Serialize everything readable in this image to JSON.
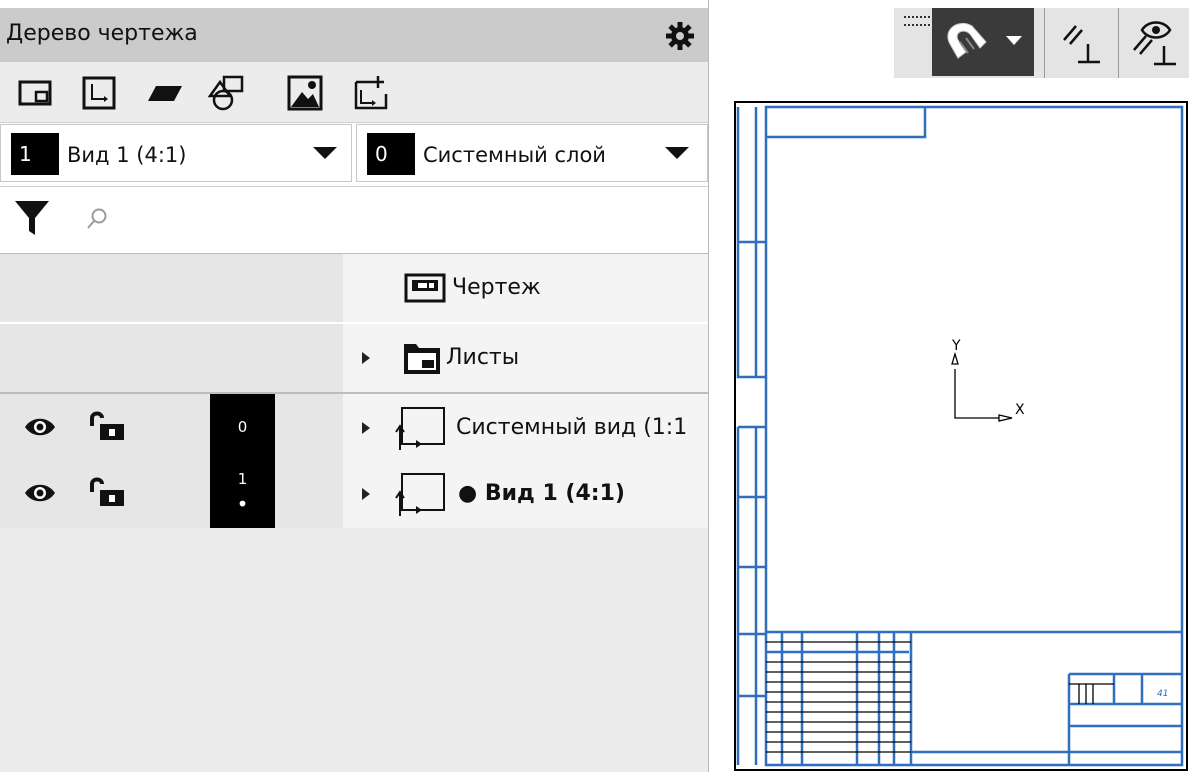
{
  "panel": {
    "title": "Дерево чертежа",
    "gear_icon": "gear-icon"
  },
  "toolbar": {
    "icons": [
      "sheet-view-icon",
      "local-cs-icon",
      "plane-icon",
      "shapes-icon",
      "image-icon",
      "layout-view-icon"
    ]
  },
  "view_combo": {
    "number": "1",
    "label": "Вид 1 (4:1)"
  },
  "layer_combo": {
    "number": "0",
    "label": "Системный слой"
  },
  "filter": {
    "search_placeholder": ""
  },
  "tree": {
    "rows": [
      {
        "label": "Чертеж",
        "icon": "drawing-icon"
      },
      {
        "label": "Листы",
        "icon": "sheets-folder-icon"
      },
      {
        "label": "Системный вид (1:1",
        "number": "0",
        "icon": "view-icon"
      },
      {
        "label": "● Вид 1 (4:1)",
        "number": "1",
        "dot": "•",
        "icon": "view-icon"
      }
    ]
  },
  "canvas": {
    "axis_y": "Y",
    "axis_x": "X",
    "stamp_value": "41"
  },
  "colors": {
    "accent": "#2f6fbd",
    "titlebar": "#cbcbcb",
    "dark_button": "#3a3a3a"
  }
}
